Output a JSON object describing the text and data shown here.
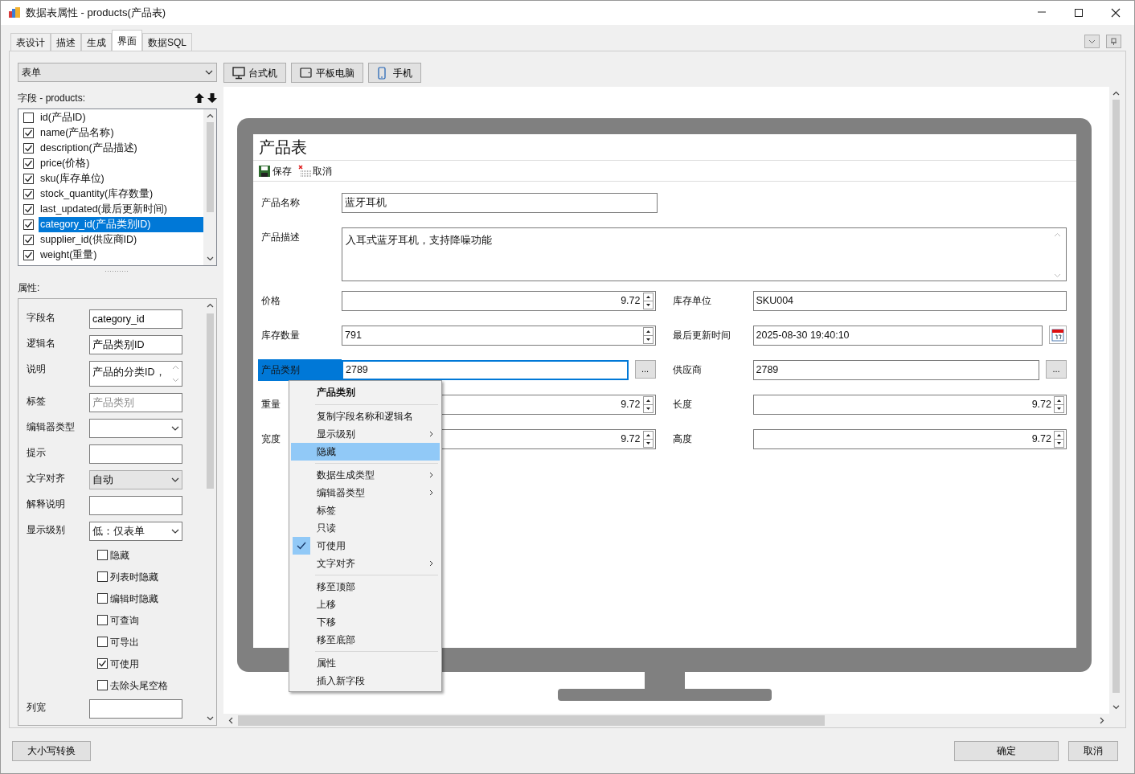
{
  "window": {
    "title": "数据表属性 - products(产品表)"
  },
  "tabs": [
    {
      "label": "表设计",
      "selected": false
    },
    {
      "label": "描述",
      "selected": false
    },
    {
      "label": "生成",
      "selected": false
    },
    {
      "label": "界面",
      "selected": true
    },
    {
      "label": "数据SQL",
      "selected": false
    }
  ],
  "layout_select": {
    "value": "表单"
  },
  "fields_panel": {
    "title": "字段 - products:",
    "items": [
      {
        "label": "id(产品ID)",
        "checked": false,
        "selected": false
      },
      {
        "label": "name(产品名称)",
        "checked": true,
        "selected": false
      },
      {
        "label": "description(产品描述)",
        "checked": true,
        "selected": false
      },
      {
        "label": "price(价格)",
        "checked": true,
        "selected": false
      },
      {
        "label": "sku(库存单位)",
        "checked": true,
        "selected": false
      },
      {
        "label": "stock_quantity(库存数量)",
        "checked": true,
        "selected": false
      },
      {
        "label": "last_updated(最后更新时间)",
        "checked": true,
        "selected": false
      },
      {
        "label": "category_id(产品类别ID)",
        "checked": true,
        "selected": true
      },
      {
        "label": "supplier_id(供应商ID)",
        "checked": true,
        "selected": false
      },
      {
        "label": "weight(重量)",
        "checked": true,
        "selected": false
      }
    ]
  },
  "properties_panel": {
    "title": "属性:",
    "items": [
      {
        "kind": "text",
        "label": "字段名",
        "value": "category_id"
      },
      {
        "kind": "text",
        "label": "逻辑名",
        "value": "产品类别ID"
      },
      {
        "kind": "textarea",
        "label": "说明",
        "value": "产品的分类ID，"
      },
      {
        "kind": "text",
        "label": "标签",
        "placeholder": "产品类别"
      },
      {
        "kind": "select",
        "label": "编辑器类型"
      },
      {
        "kind": "text",
        "label": "提示"
      },
      {
        "kind": "list",
        "label": "文字对齐",
        "value": "自动"
      },
      {
        "kind": "text",
        "label": "解释说明"
      },
      {
        "kind": "select",
        "label": "显示级别",
        "value": "低：仅表单"
      },
      {
        "kind": "checkbox",
        "label": "隐藏",
        "checked": false
      },
      {
        "kind": "checkbox",
        "label": "列表时隐藏",
        "checked": false
      },
      {
        "kind": "checkbox",
        "label": "编辑时隐藏",
        "checked": false
      },
      {
        "kind": "checkbox",
        "label": "可查询",
        "checked": false
      },
      {
        "kind": "checkbox",
        "label": "可导出",
        "checked": false
      },
      {
        "kind": "checkbox",
        "label": "可使用",
        "checked": true
      },
      {
        "kind": "checkbox",
        "label": "去除头尾空格",
        "checked": false
      },
      {
        "kind": "text",
        "label": "列宽"
      }
    ]
  },
  "device_buttons": [
    {
      "kind": "desktop",
      "label": "台式机"
    },
    {
      "kind": "tablet",
      "label": "平板电脑"
    },
    {
      "kind": "phone",
      "label": "手机"
    }
  ],
  "form_preview": {
    "title": "产品表",
    "toolbar": [
      {
        "kind": "save",
        "label": "保存"
      },
      {
        "kind": "cancel",
        "label": "取消"
      }
    ],
    "rows": [
      [
        {
          "label": "产品名称",
          "kind": "text",
          "value": "蓝牙耳机",
          "focused": false
        }
      ],
      [
        {
          "label": "产品描述",
          "kind": "textarea",
          "value": "入耳式蓝牙耳机，支持降噪功能",
          "focused": false
        }
      ],
      [
        {
          "label": "价格",
          "kind": "number",
          "value": "9.72",
          "focused": false
        },
        {
          "label": "库存单位",
          "kind": "text",
          "value": "SKU004",
          "focused": false
        }
      ],
      [
        {
          "label": "库存数量",
          "kind": "integer",
          "value": "791",
          "focused": false
        },
        {
          "label": "最后更新时间",
          "kind": "date",
          "value": "2025-08-30 19:40:10",
          "focused": false
        }
      ],
      [
        {
          "label": "产品类别",
          "kind": "lookup",
          "value": "2789",
          "button": "...",
          "focused": true
        },
        {
          "label": "供应商",
          "kind": "lookup",
          "value": "2789",
          "button": "...",
          "focused": false
        }
      ],
      [
        {
          "label": "重量",
          "kind": "number",
          "value": "9.72",
          "focused": false
        },
        {
          "label": "长度",
          "kind": "number",
          "value": "9.72",
          "focused": false
        }
      ],
      [
        {
          "label": "宽度",
          "kind": "number",
          "value": "9.72",
          "focused": false
        },
        {
          "label": "高度",
          "kind": "number",
          "value": "9.72",
          "focused": false
        }
      ]
    ]
  },
  "context_menu": {
    "header": "产品类别",
    "groups": [
      [
        {
          "label": "复制字段名称和逻辑名",
          "submenu": false,
          "checked": false,
          "selected": false
        },
        {
          "label": "显示级别",
          "submenu": true,
          "checked": false,
          "selected": false
        },
        {
          "label": "隐藏",
          "submenu": false,
          "checked": false,
          "selected": true
        }
      ],
      [
        {
          "label": "数据生成类型",
          "submenu": true,
          "checked": false,
          "selected": false
        },
        {
          "label": "编辑器类型",
          "submenu": true,
          "checked": false,
          "selected": false
        },
        {
          "label": "标签",
          "submenu": false,
          "checked": false,
          "selected": false
        },
        {
          "label": "只读",
          "submenu": false,
          "checked": false,
          "selected": false
        },
        {
          "label": "可使用",
          "submenu": false,
          "checked": true,
          "selected": false
        },
        {
          "label": "文字对齐",
          "submenu": true,
          "checked": false,
          "selected": false
        }
      ],
      [
        {
          "label": "移至顶部",
          "submenu": false,
          "checked": false,
          "selected": false
        },
        {
          "label": "上移",
          "submenu": false,
          "checked": false,
          "selected": false
        },
        {
          "label": "下移",
          "submenu": false,
          "checked": false,
          "selected": false
        },
        {
          "label": "移至底部",
          "submenu": false,
          "checked": false,
          "selected": false
        }
      ],
      [
        {
          "label": "属性",
          "submenu": false,
          "checked": false,
          "selected": false
        },
        {
          "label": "插入新字段",
          "submenu": false,
          "checked": false,
          "selected": false
        }
      ]
    ]
  },
  "footer": {
    "left_button": "大小写转换",
    "buttons": [
      "确定",
      "取消"
    ]
  }
}
